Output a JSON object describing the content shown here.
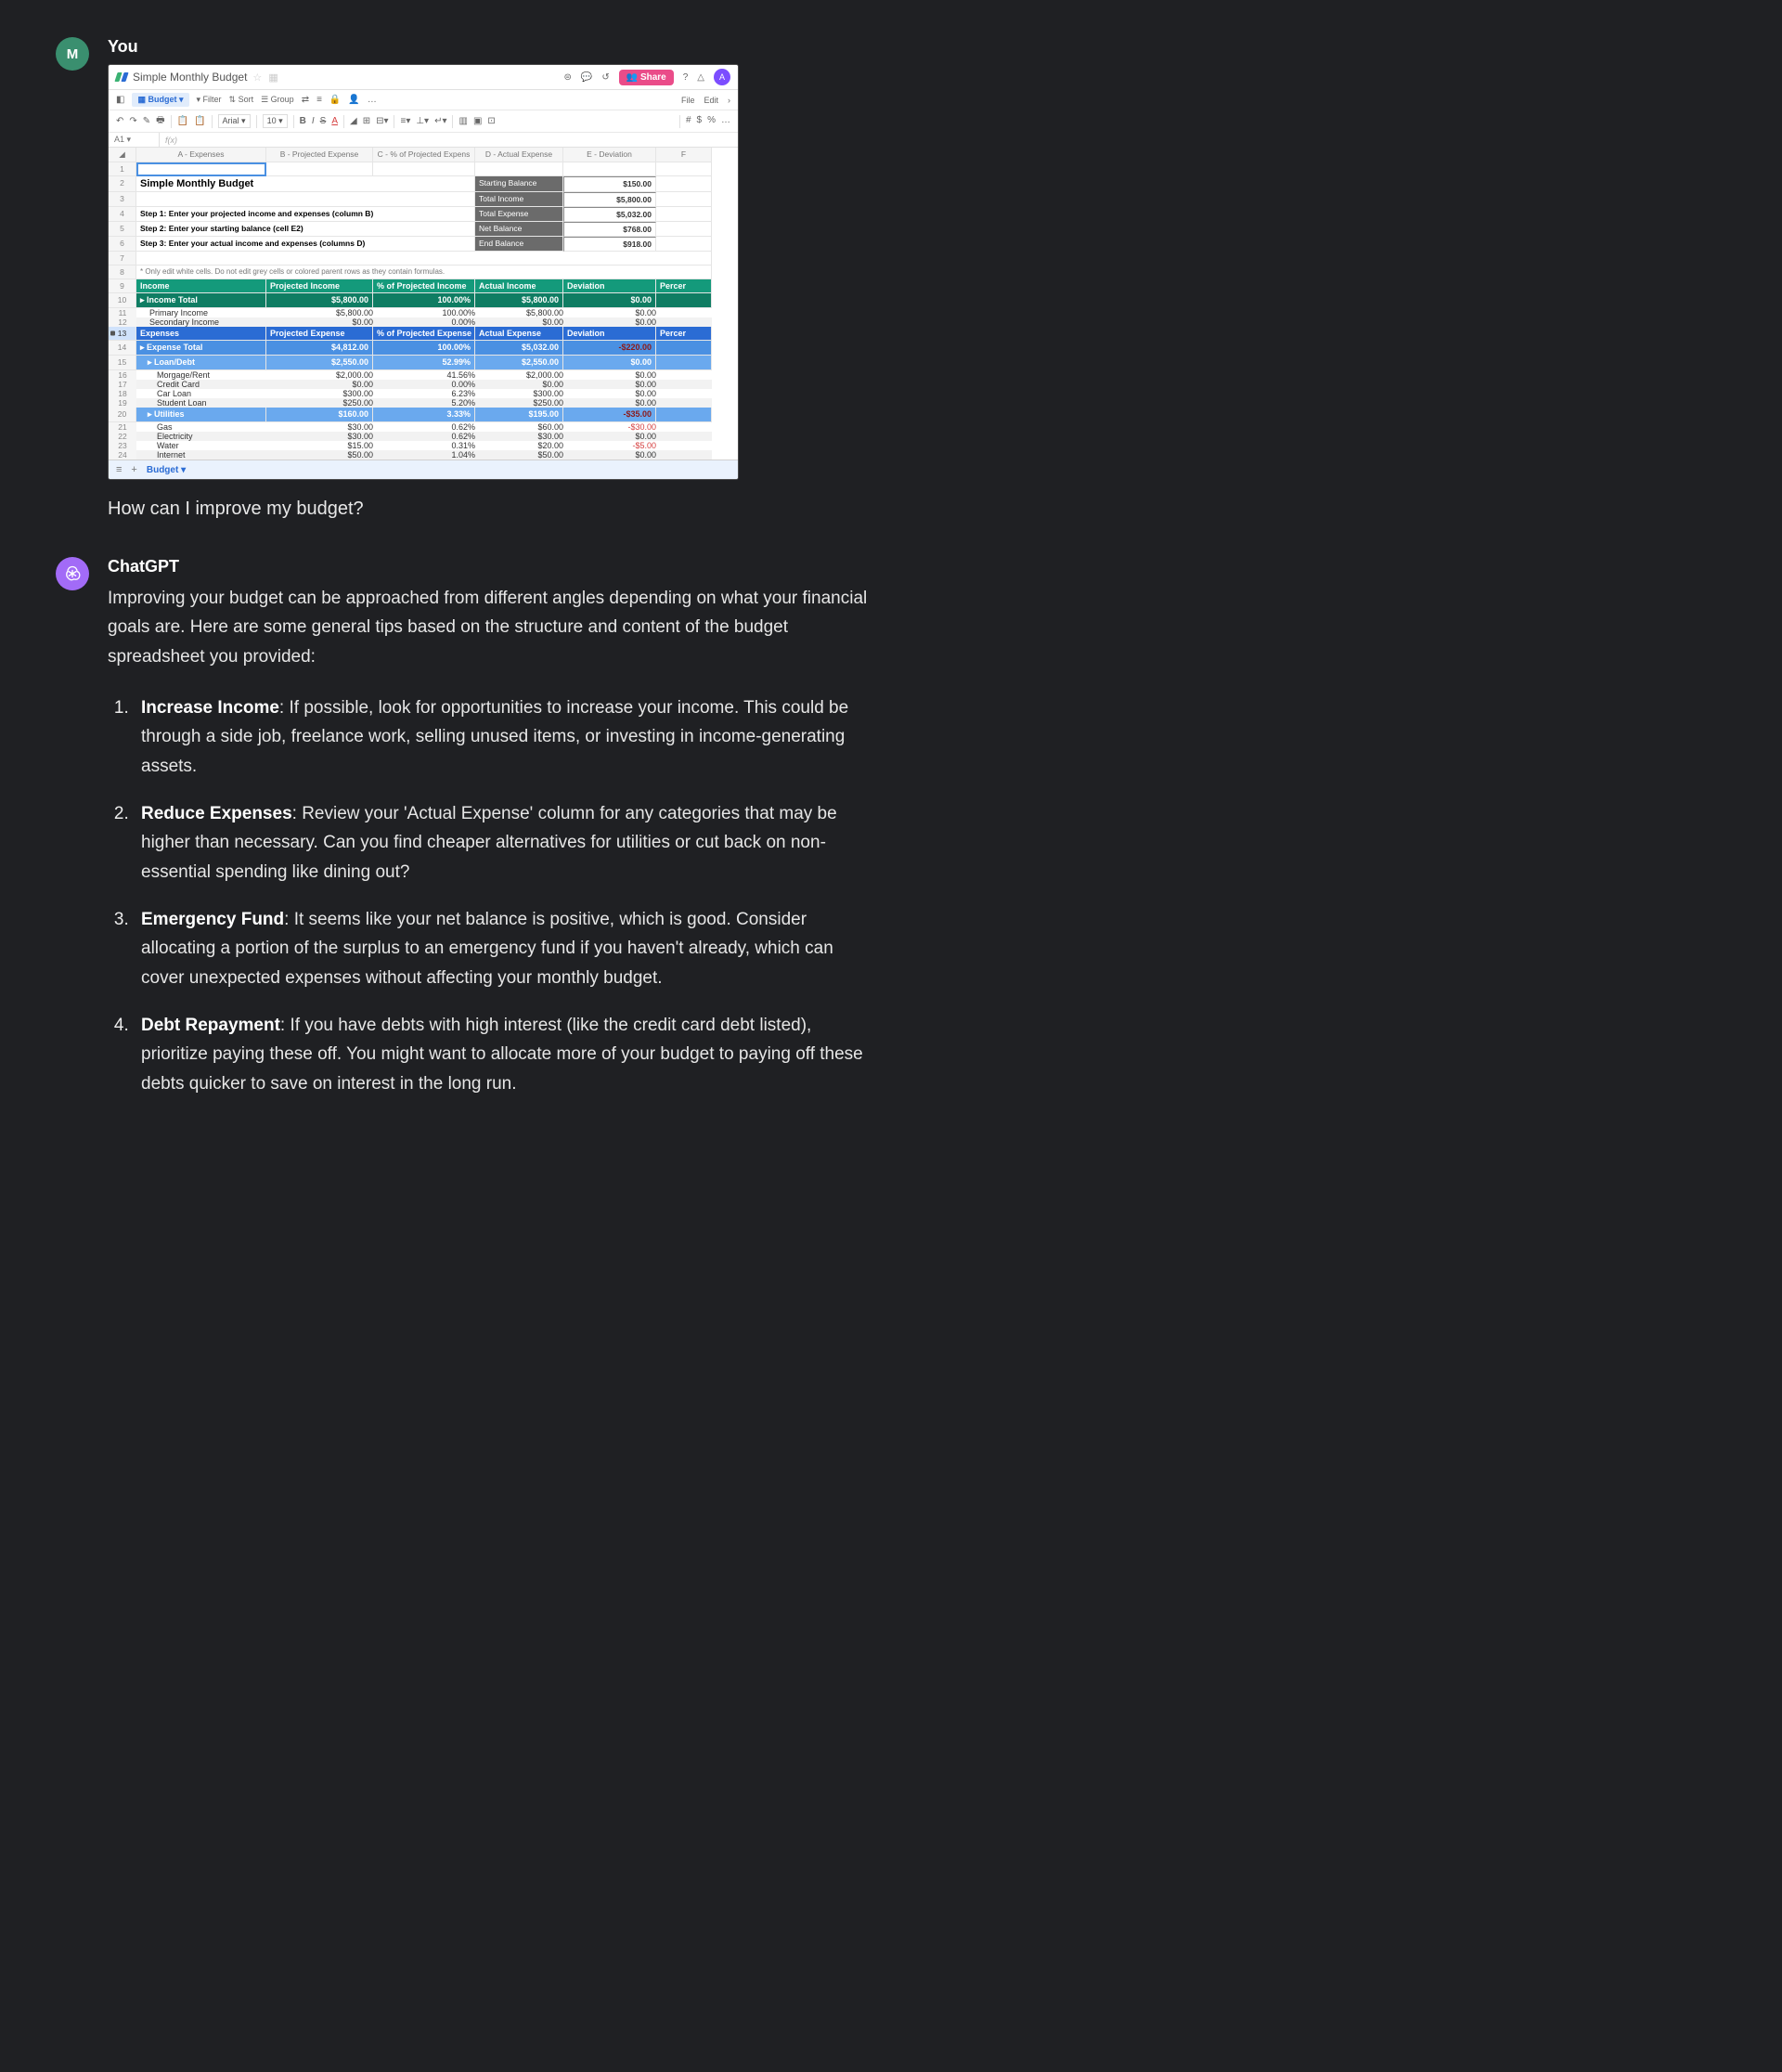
{
  "user": {
    "avatar_letter": "M",
    "name": "You",
    "question": "How can I improve my budget?"
  },
  "assistant": {
    "name": "ChatGPT"
  },
  "sheet": {
    "doc_name": "Simple Monthly Budget",
    "share_label": "Share",
    "profile_letter": "A",
    "menubar": {
      "budget": "Budget",
      "filter": "Filter",
      "sort": "Sort",
      "group": "Group",
      "file": "File",
      "edit": "Edit"
    },
    "toolbar": {
      "font": "Arial",
      "size": "10"
    },
    "fx_cell": "A1",
    "fx_label": "f(x)",
    "columns": {
      "corner": "",
      "a": "A - Expenses",
      "b": "B - Projected Expense",
      "c": "C - % of Projected Expens",
      "d": "D - Actual Expense",
      "e": "E - Deviation",
      "f": "F"
    },
    "title_row": "Simple Monthly Budget",
    "steps": {
      "s1": "Step 1: Enter your projected income and expenses (column B)",
      "s2": "Step 2: Enter your starting balance (cell E2)",
      "s3": "Step 3: Enter your actual income and expenses (columns D)"
    },
    "note": "* Only edit white cells. Do not edit grey cells or colored parent rows as they contain formulas.",
    "summary": [
      {
        "label": "Starting Balance",
        "value": "$150.00"
      },
      {
        "label": "Total Income",
        "value": "$5,800.00"
      },
      {
        "label": "Total Expense",
        "value": "$5,032.00"
      },
      {
        "label": "Net Balance",
        "value": "$768.00"
      },
      {
        "label": "End Balance",
        "value": "$918.00"
      }
    ],
    "income_header": {
      "a": "Income",
      "b": "Projected Income",
      "c": "% of Projected Income",
      "d": "Actual Income",
      "e": "Deviation",
      "f": "Percer"
    },
    "income_total": {
      "a": "Income Total",
      "b": "$5,800.00",
      "c": "100.00%",
      "d": "$5,800.00",
      "e": "$0.00"
    },
    "income_rows": [
      {
        "n": "11",
        "a": "Primary Income",
        "b": "$5,800.00",
        "c": "100.00%",
        "d": "$5,800.00",
        "e": "$0.00"
      },
      {
        "n": "12",
        "a": "Secondary Income",
        "b": "$0.00",
        "c": "0.00%",
        "d": "$0.00",
        "e": "$0.00"
      }
    ],
    "expense_header": {
      "a": "Expenses",
      "b": "Projected Expense",
      "c": "% of Projected Expense",
      "d": "Actual Expense",
      "e": "Deviation",
      "f": "Percer"
    },
    "expense_total": {
      "a": "Expense Total",
      "b": "$4,812.00",
      "c": "100.00%",
      "d": "$5,032.00",
      "e": "-$220.00"
    },
    "loan_debt": {
      "a": "Loan/Debt",
      "b": "$2,550.00",
      "c": "52.99%",
      "d": "$2,550.00",
      "e": "$0.00"
    },
    "loan_rows": [
      {
        "n": "16",
        "a": "Morgage/Rent",
        "b": "$2,000.00",
        "c": "41.56%",
        "d": "$2,000.00",
        "e": "$0.00"
      },
      {
        "n": "17",
        "a": "Credit Card",
        "b": "$0.00",
        "c": "0.00%",
        "d": "$0.00",
        "e": "$0.00"
      },
      {
        "n": "18",
        "a": "Car Loan",
        "b": "$300.00",
        "c": "6.23%",
        "d": "$300.00",
        "e": "$0.00"
      },
      {
        "n": "19",
        "a": "Student Loan",
        "b": "$250.00",
        "c": "5.20%",
        "d": "$250.00",
        "e": "$0.00"
      }
    ],
    "utilities": {
      "a": "Utilities",
      "b": "$160.00",
      "c": "3.33%",
      "d": "$195.00",
      "e": "-$35.00"
    },
    "util_rows": [
      {
        "n": "21",
        "a": "Gas",
        "b": "$30.00",
        "c": "0.62%",
        "d": "$60.00",
        "e": "-$30.00",
        "red": true
      },
      {
        "n": "22",
        "a": "Electricity",
        "b": "$30.00",
        "c": "0.62%",
        "d": "$30.00",
        "e": "$0.00"
      },
      {
        "n": "23",
        "a": "Water",
        "b": "$15.00",
        "c": "0.31%",
        "d": "$20.00",
        "e": "-$5.00",
        "red": true
      },
      {
        "n": "24",
        "a": "Internet",
        "b": "$50.00",
        "c": "1.04%",
        "d": "$50.00",
        "e": "$0.00"
      }
    ],
    "tab_name": "Budget"
  },
  "response": {
    "intro": "Improving your budget can be approached from different angles depending on what your financial goals are. Here are some general tips based on the structure and content of the budget spreadsheet you provided:",
    "tips": [
      {
        "title": "Increase Income",
        "text": ": If possible, look for opportunities to increase your income. This could be through a side job, freelance work, selling unused items, or investing in income-generating assets."
      },
      {
        "title": "Reduce Expenses",
        "text": ": Review your 'Actual Expense' column for any categories that may be higher than necessary. Can you find cheaper alternatives for utilities or cut back on non-essential spending like dining out?"
      },
      {
        "title": "Emergency Fund",
        "text": ": It seems like your net balance is positive, which is good. Consider allocating a portion of the surplus to an emergency fund if you haven't already, which can cover unexpected expenses without affecting your monthly budget."
      },
      {
        "title": "Debt Repayment",
        "text": ": If you have debts with high interest (like the credit card debt listed), prioritize paying these off. You might want to allocate more of your budget to paying off these debts quicker to save on interest in the long run."
      }
    ]
  }
}
